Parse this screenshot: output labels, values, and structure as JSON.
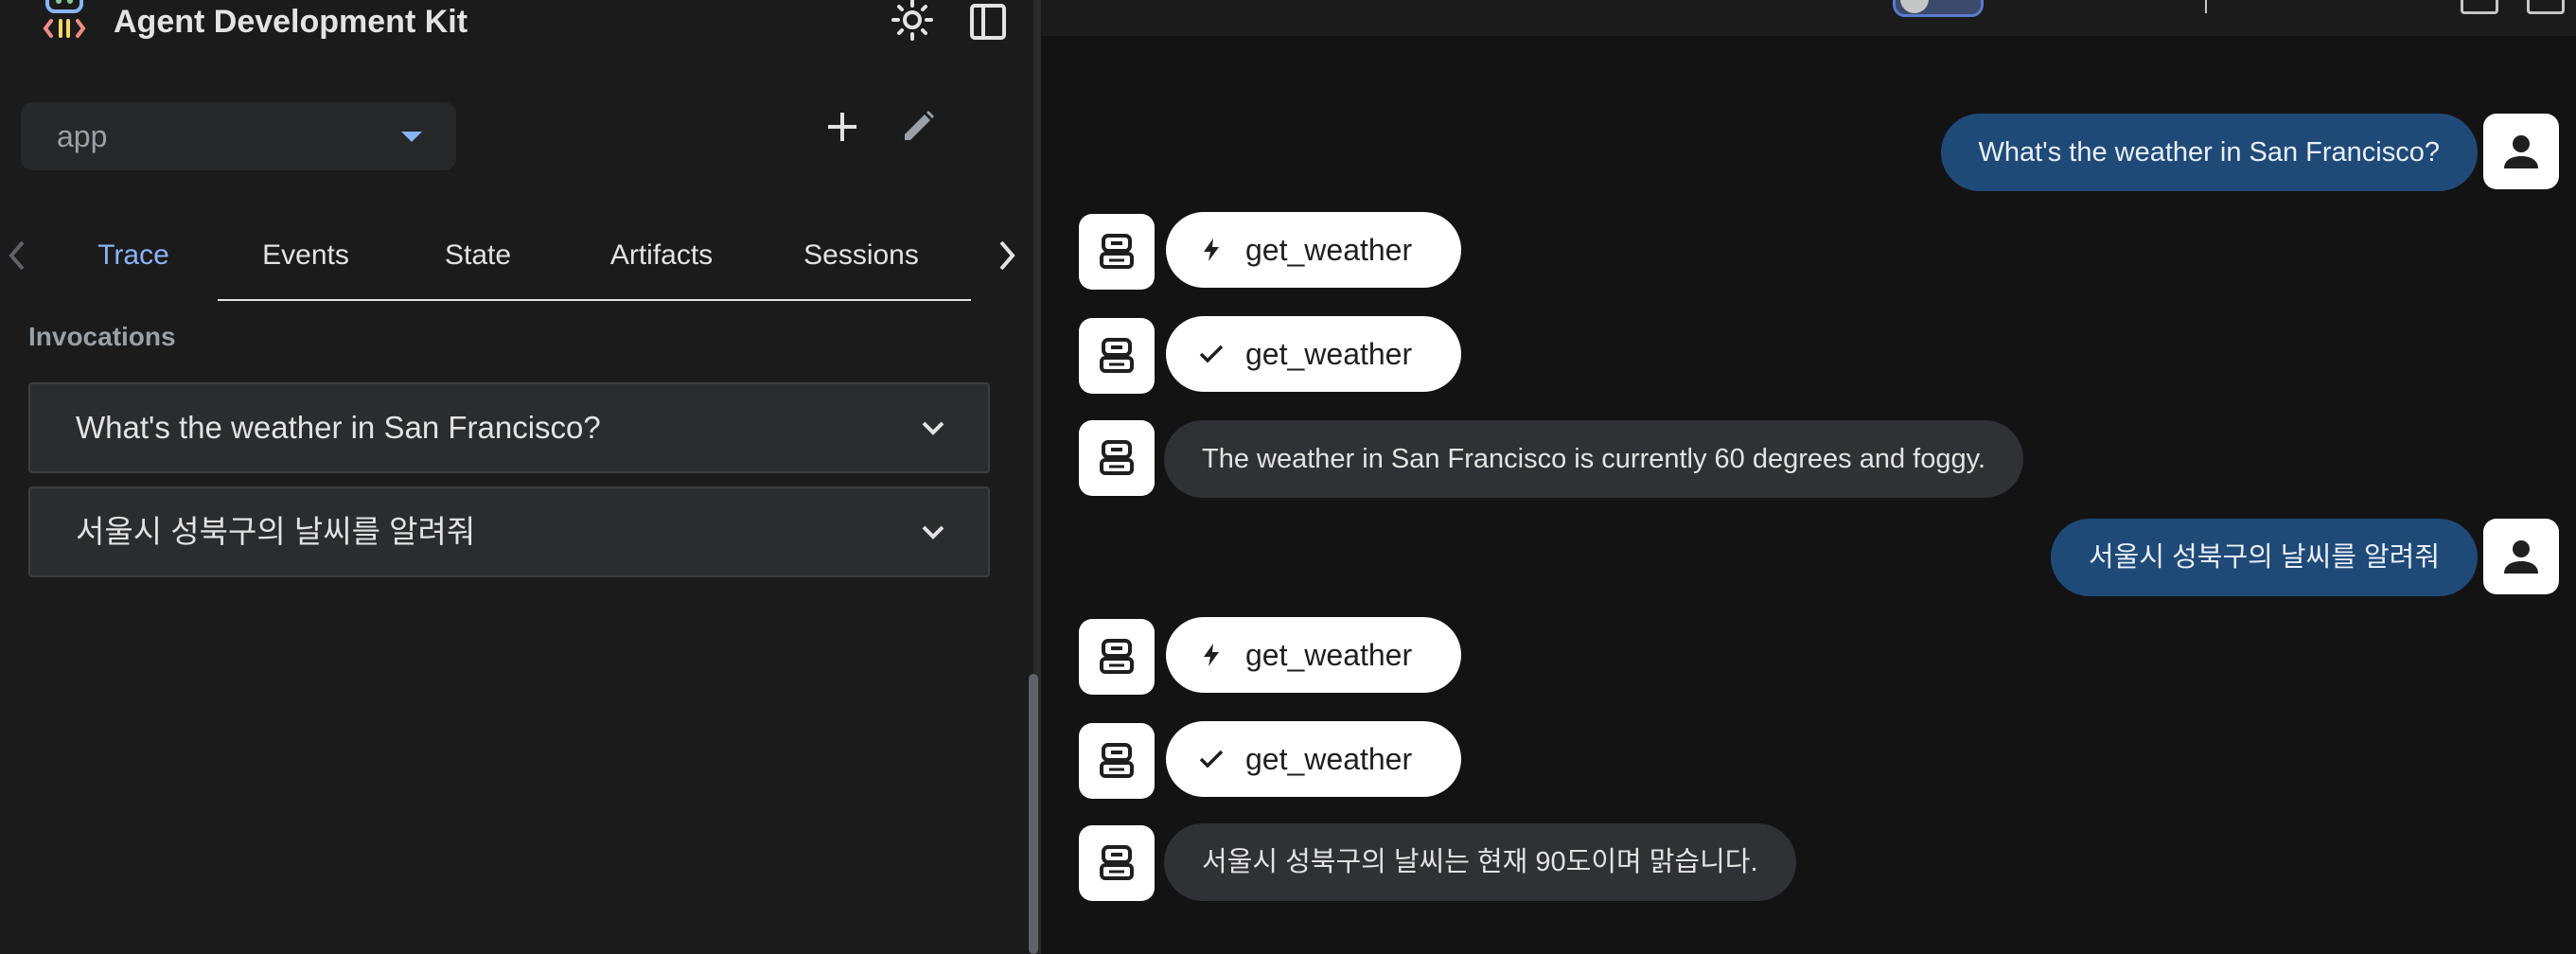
{
  "app": {
    "title": "Agent Development Kit",
    "logo_icon": "adk-logo-icon",
    "theme_icon": "sun-icon",
    "collapse_icon": "sidebar-collapse-icon"
  },
  "sidebar": {
    "app_selector": {
      "value": "app"
    },
    "add_icon": "plus-icon",
    "edit_icon": "pencil-icon",
    "tabs": [
      {
        "label": "Trace",
        "active": true
      },
      {
        "label": "Events",
        "active": false
      },
      {
        "label": "State",
        "active": false
      },
      {
        "label": "Artifacts",
        "active": false
      },
      {
        "label": "Sessions",
        "active": false
      }
    ],
    "section_label": "Invocations",
    "invocations": [
      {
        "label": "What's the weather in San Francisco?"
      },
      {
        "label": "서울시 성북구의 날씨를 알려줘"
      }
    ]
  },
  "chat": {
    "messages": [
      {
        "role": "user",
        "kind": "text",
        "text": "What's the weather in San Francisco?"
      },
      {
        "role": "bot",
        "kind": "function_call",
        "icon": "bolt-icon",
        "text": "get_weather"
      },
      {
        "role": "bot",
        "kind": "function_response",
        "icon": "check-icon",
        "text": "get_weather"
      },
      {
        "role": "bot",
        "kind": "text",
        "text": "The weather in San Francisco is currently 60 degrees and foggy."
      },
      {
        "role": "user",
        "kind": "text",
        "text": "서울시 성북구의 날씨를 알려줘"
      },
      {
        "role": "bot",
        "kind": "function_call",
        "icon": "bolt-icon",
        "text": "get_weather"
      },
      {
        "role": "bot",
        "kind": "function_response",
        "icon": "check-icon",
        "text": "get_weather"
      },
      {
        "role": "bot",
        "kind": "text",
        "text": "서울시 성북구의 날씨는 현재 90도이며 맑습니다."
      }
    ]
  },
  "colors": {
    "accent": "#8ab4f8",
    "user_bubble": "#1f4a78",
    "bot_bubble": "#303134",
    "sidebar_bg": "#1b1b1c",
    "main_bg": "#131314"
  }
}
